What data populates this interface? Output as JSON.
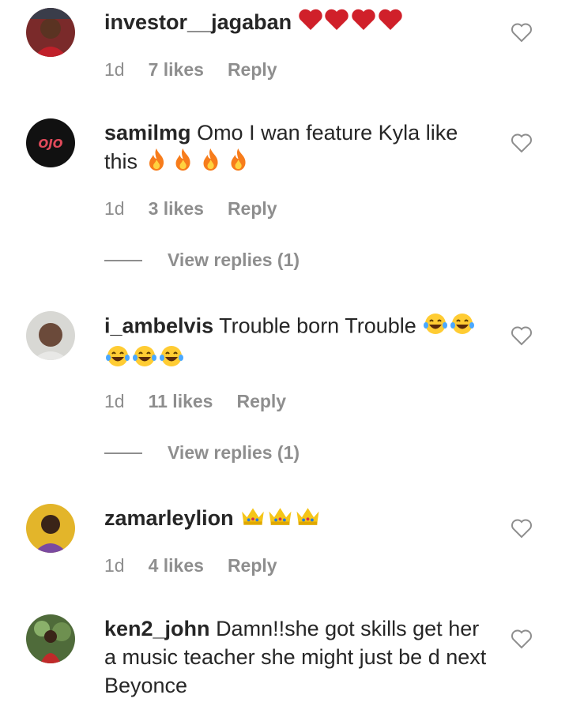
{
  "comments": [
    {
      "username": "investor__jagaban",
      "text": " ",
      "emoji": [
        "red-heart",
        "red-heart",
        "red-heart",
        "red-heart"
      ],
      "time": "1d",
      "likes": "7 likes",
      "reply": "Reply"
    },
    {
      "username": "samilmg",
      "text": "Omo I wan feature Kyla like this",
      "emoji": [
        "fire",
        "fire",
        "fire",
        "fire"
      ],
      "time": "1d",
      "likes": "3 likes",
      "reply": "Reply",
      "view_replies": "View replies (1)",
      "avatar_text": "OJO"
    },
    {
      "username": "i_ambelvis",
      "text": "Trouble born Trouble",
      "emoji": [
        "tears-of-joy",
        "tears-of-joy",
        "tears-of-joy",
        "tears-of-joy",
        "tears-of-joy"
      ],
      "time": "1d",
      "likes": "11 likes",
      "reply": "Reply",
      "view_replies": "View replies (1)"
    },
    {
      "username": "zamarleylion",
      "text": " ",
      "emoji": [
        "crown",
        "crown",
        "crown"
      ],
      "time": "1d",
      "likes": "4 likes",
      "reply": "Reply"
    },
    {
      "username": "ken2_john",
      "text": "Damn!!she got skills get her a music teacher she might just be d next Beyonce"
    }
  ],
  "colors": {
    "text": "#262626",
    "muted": "#8e8e8e",
    "heart": "#e0245e",
    "fire": "#f77c1b",
    "crown": "#f5c518"
  }
}
